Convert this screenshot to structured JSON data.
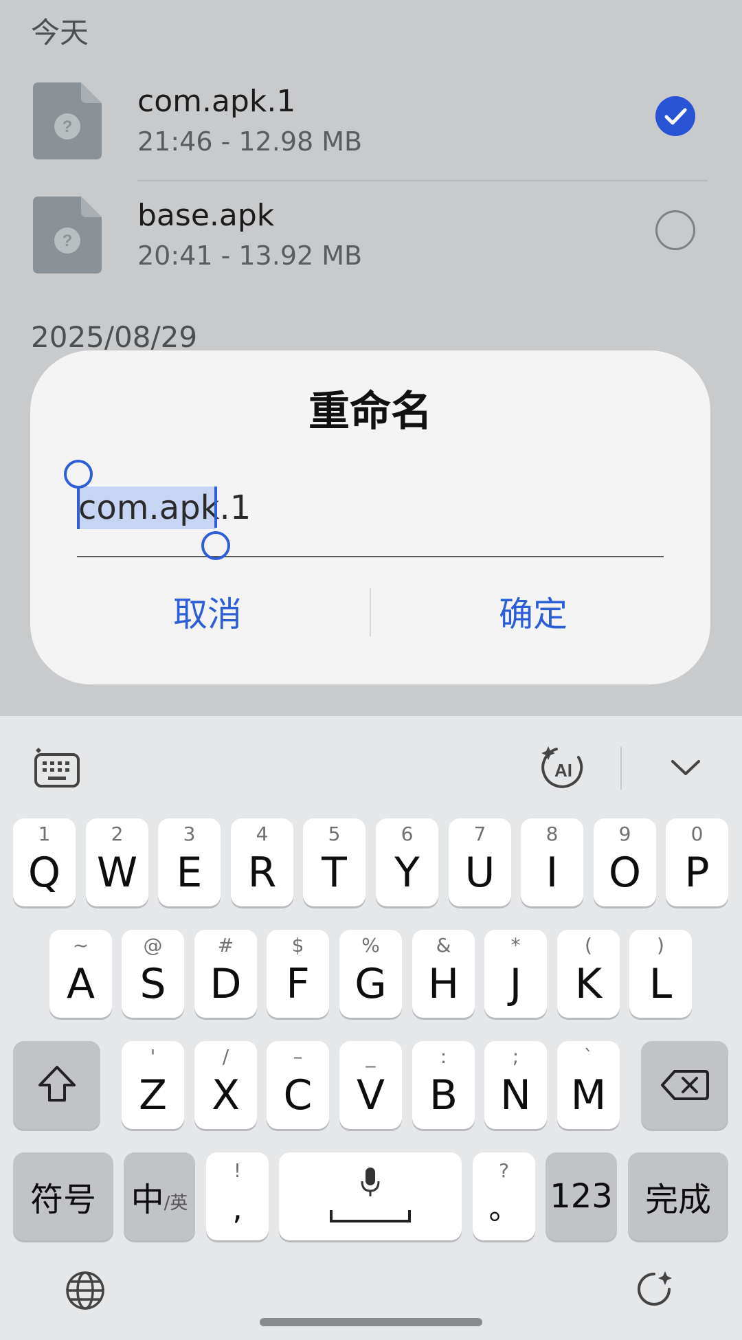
{
  "file_list": {
    "sections": [
      {
        "label": "今天",
        "files": [
          {
            "name": "com.apk.1",
            "meta": "21:46 - 12.98 MB",
            "selected": true
          },
          {
            "name": "base.apk",
            "meta": "20:41 - 13.92 MB",
            "selected": false
          }
        ]
      },
      {
        "label": "2025/08/29",
        "files": []
      }
    ]
  },
  "dialog": {
    "title": "重命名",
    "input_value": "com.apk.1",
    "selected_text": "com.apk",
    "cancel_label": "取消",
    "confirm_label": "确定"
  },
  "keyboard": {
    "toolbar": {
      "left_icon": "keyboard-settings-icon",
      "ai_icon": "ai-sparkle-icon",
      "collapse_icon": "chevron-down-icon"
    },
    "row1": [
      {
        "sub": "1",
        "main": "Q"
      },
      {
        "sub": "2",
        "main": "W"
      },
      {
        "sub": "3",
        "main": "E"
      },
      {
        "sub": "4",
        "main": "R"
      },
      {
        "sub": "5",
        "main": "T"
      },
      {
        "sub": "6",
        "main": "Y"
      },
      {
        "sub": "7",
        "main": "U"
      },
      {
        "sub": "8",
        "main": "I"
      },
      {
        "sub": "9",
        "main": "O"
      },
      {
        "sub": "0",
        "main": "P"
      }
    ],
    "row2": [
      {
        "sub": "~",
        "main": "A"
      },
      {
        "sub": "@",
        "main": "S"
      },
      {
        "sub": "#",
        "main": "D"
      },
      {
        "sub": "$",
        "main": "F"
      },
      {
        "sub": "%",
        "main": "G"
      },
      {
        "sub": "&",
        "main": "H"
      },
      {
        "sub": "*",
        "main": "J"
      },
      {
        "sub": "(",
        "main": "K"
      },
      {
        "sub": ")",
        "main": "L"
      }
    ],
    "row3": [
      {
        "sub": "'",
        "main": "Z"
      },
      {
        "sub": "/",
        "main": "X"
      },
      {
        "sub": "–",
        "main": "C"
      },
      {
        "sub": "_",
        "main": "V"
      },
      {
        "sub": ":",
        "main": "B"
      },
      {
        "sub": ";",
        "main": "N"
      },
      {
        "sub": "`",
        "main": "M"
      }
    ],
    "bottom": {
      "symbols": "符号",
      "lang_main": "中",
      "lang_sub": "/英",
      "comma_sub": "!",
      "comma_main": ",",
      "period_sub": "?",
      "period_main": "。",
      "numbers": "123",
      "done": "完成"
    },
    "footer": {
      "left_icon": "globe-icon",
      "right_icon": "rotate-icon"
    }
  }
}
